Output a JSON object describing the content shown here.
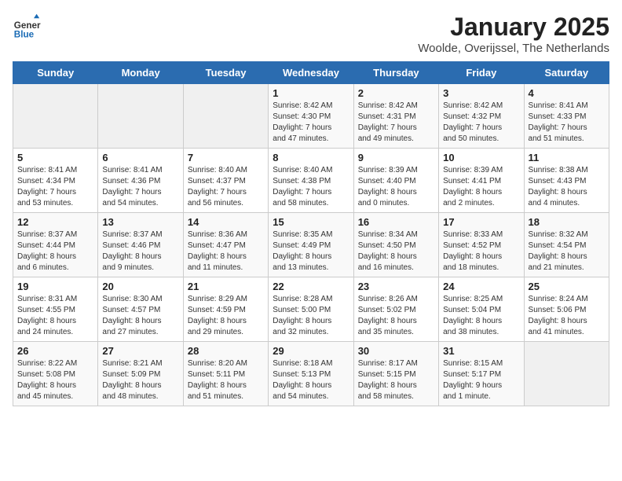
{
  "logo": {
    "general": "General",
    "blue": "Blue"
  },
  "title": "January 2025",
  "subtitle": "Woolde, Overijssel, The Netherlands",
  "weekdays": [
    "Sunday",
    "Monday",
    "Tuesday",
    "Wednesday",
    "Thursday",
    "Friday",
    "Saturday"
  ],
  "weeks": [
    [
      {
        "day": "",
        "info": ""
      },
      {
        "day": "",
        "info": ""
      },
      {
        "day": "",
        "info": ""
      },
      {
        "day": "1",
        "info": "Sunrise: 8:42 AM\nSunset: 4:30 PM\nDaylight: 7 hours\nand 47 minutes."
      },
      {
        "day": "2",
        "info": "Sunrise: 8:42 AM\nSunset: 4:31 PM\nDaylight: 7 hours\nand 49 minutes."
      },
      {
        "day": "3",
        "info": "Sunrise: 8:42 AM\nSunset: 4:32 PM\nDaylight: 7 hours\nand 50 minutes."
      },
      {
        "day": "4",
        "info": "Sunrise: 8:41 AM\nSunset: 4:33 PM\nDaylight: 7 hours\nand 51 minutes."
      }
    ],
    [
      {
        "day": "5",
        "info": "Sunrise: 8:41 AM\nSunset: 4:34 PM\nDaylight: 7 hours\nand 53 minutes."
      },
      {
        "day": "6",
        "info": "Sunrise: 8:41 AM\nSunset: 4:36 PM\nDaylight: 7 hours\nand 54 minutes."
      },
      {
        "day": "7",
        "info": "Sunrise: 8:40 AM\nSunset: 4:37 PM\nDaylight: 7 hours\nand 56 minutes."
      },
      {
        "day": "8",
        "info": "Sunrise: 8:40 AM\nSunset: 4:38 PM\nDaylight: 7 hours\nand 58 minutes."
      },
      {
        "day": "9",
        "info": "Sunrise: 8:39 AM\nSunset: 4:40 PM\nDaylight: 8 hours\nand 0 minutes."
      },
      {
        "day": "10",
        "info": "Sunrise: 8:39 AM\nSunset: 4:41 PM\nDaylight: 8 hours\nand 2 minutes."
      },
      {
        "day": "11",
        "info": "Sunrise: 8:38 AM\nSunset: 4:43 PM\nDaylight: 8 hours\nand 4 minutes."
      }
    ],
    [
      {
        "day": "12",
        "info": "Sunrise: 8:37 AM\nSunset: 4:44 PM\nDaylight: 8 hours\nand 6 minutes."
      },
      {
        "day": "13",
        "info": "Sunrise: 8:37 AM\nSunset: 4:46 PM\nDaylight: 8 hours\nand 9 minutes."
      },
      {
        "day": "14",
        "info": "Sunrise: 8:36 AM\nSunset: 4:47 PM\nDaylight: 8 hours\nand 11 minutes."
      },
      {
        "day": "15",
        "info": "Sunrise: 8:35 AM\nSunset: 4:49 PM\nDaylight: 8 hours\nand 13 minutes."
      },
      {
        "day": "16",
        "info": "Sunrise: 8:34 AM\nSunset: 4:50 PM\nDaylight: 8 hours\nand 16 minutes."
      },
      {
        "day": "17",
        "info": "Sunrise: 8:33 AM\nSunset: 4:52 PM\nDaylight: 8 hours\nand 18 minutes."
      },
      {
        "day": "18",
        "info": "Sunrise: 8:32 AM\nSunset: 4:54 PM\nDaylight: 8 hours\nand 21 minutes."
      }
    ],
    [
      {
        "day": "19",
        "info": "Sunrise: 8:31 AM\nSunset: 4:55 PM\nDaylight: 8 hours\nand 24 minutes."
      },
      {
        "day": "20",
        "info": "Sunrise: 8:30 AM\nSunset: 4:57 PM\nDaylight: 8 hours\nand 27 minutes."
      },
      {
        "day": "21",
        "info": "Sunrise: 8:29 AM\nSunset: 4:59 PM\nDaylight: 8 hours\nand 29 minutes."
      },
      {
        "day": "22",
        "info": "Sunrise: 8:28 AM\nSunset: 5:00 PM\nDaylight: 8 hours\nand 32 minutes."
      },
      {
        "day": "23",
        "info": "Sunrise: 8:26 AM\nSunset: 5:02 PM\nDaylight: 8 hours\nand 35 minutes."
      },
      {
        "day": "24",
        "info": "Sunrise: 8:25 AM\nSunset: 5:04 PM\nDaylight: 8 hours\nand 38 minutes."
      },
      {
        "day": "25",
        "info": "Sunrise: 8:24 AM\nSunset: 5:06 PM\nDaylight: 8 hours\nand 41 minutes."
      }
    ],
    [
      {
        "day": "26",
        "info": "Sunrise: 8:22 AM\nSunset: 5:08 PM\nDaylight: 8 hours\nand 45 minutes."
      },
      {
        "day": "27",
        "info": "Sunrise: 8:21 AM\nSunset: 5:09 PM\nDaylight: 8 hours\nand 48 minutes."
      },
      {
        "day": "28",
        "info": "Sunrise: 8:20 AM\nSunset: 5:11 PM\nDaylight: 8 hours\nand 51 minutes."
      },
      {
        "day": "29",
        "info": "Sunrise: 8:18 AM\nSunset: 5:13 PM\nDaylight: 8 hours\nand 54 minutes."
      },
      {
        "day": "30",
        "info": "Sunrise: 8:17 AM\nSunset: 5:15 PM\nDaylight: 8 hours\nand 58 minutes."
      },
      {
        "day": "31",
        "info": "Sunrise: 8:15 AM\nSunset: 5:17 PM\nDaylight: 9 hours\nand 1 minute."
      },
      {
        "day": "",
        "info": ""
      }
    ]
  ]
}
